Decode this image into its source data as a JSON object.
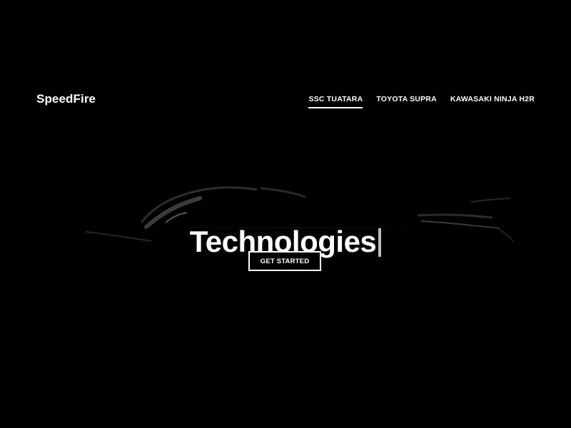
{
  "brand": {
    "name": "SpeedFire"
  },
  "nav": {
    "items": [
      {
        "label": "SSC TUATARA",
        "active": true
      },
      {
        "label": "TOYOTA SUPRA",
        "active": false
      },
      {
        "label": "KAWASAKI NINJA H2R",
        "active": false
      }
    ]
  },
  "hero": {
    "title": "Technologies",
    "cta_label": "GET STARTED"
  },
  "colors": {
    "background": "#000000",
    "text": "#ffffff",
    "cursor": "#bdbdbd"
  }
}
